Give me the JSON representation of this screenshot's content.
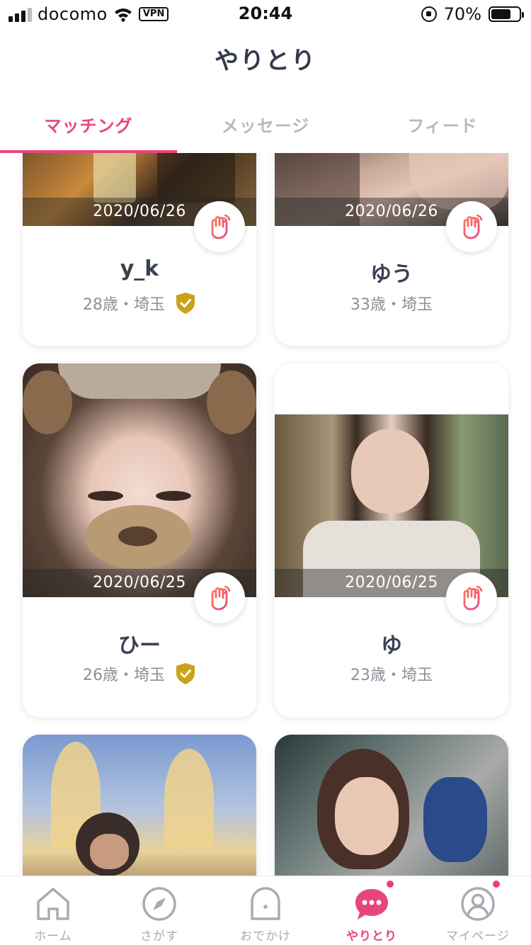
{
  "status_bar": {
    "carrier": "docomo",
    "vpn": "VPN",
    "time": "20:44",
    "battery_percent": "70%",
    "battery_level": 0.7
  },
  "header": {
    "title": "やりとり"
  },
  "tabs": [
    {
      "label": "マッチング",
      "active": true
    },
    {
      "label": "メッセージ",
      "active": false
    },
    {
      "label": "フィード",
      "active": false
    }
  ],
  "cards": [
    {
      "date": "2020/06/26",
      "name": "y_k",
      "meta": "28歳・埼玉",
      "verified": true
    },
    {
      "date": "2020/06/26",
      "name": "ゆう",
      "meta": "33歳・埼玉",
      "verified": false
    },
    {
      "date": "2020/06/25",
      "name": "ひー",
      "meta": "26歳・埼玉",
      "verified": true
    },
    {
      "date": "2020/06/25",
      "name": "ゆ",
      "meta": "23歳・埼玉",
      "verified": false
    }
  ],
  "bottom_nav": [
    {
      "label": "ホーム",
      "icon": "home-icon",
      "active": false,
      "badge": false
    },
    {
      "label": "さがす",
      "icon": "compass-icon",
      "active": false,
      "badge": false
    },
    {
      "label": "おでかけ",
      "icon": "ghost-icon",
      "active": false,
      "badge": false
    },
    {
      "label": "やりとり",
      "icon": "chat-bubble-icon",
      "active": true,
      "badge": true
    },
    {
      "label": "マイページ",
      "icon": "profile-icon",
      "active": false,
      "badge": true
    }
  ],
  "colors": {
    "accent": "#e8457b",
    "badge": "#f23d6b",
    "verified_shield": "#c9a21a",
    "wave_gradient": [
      "#ff7a59",
      "#e8457b"
    ]
  }
}
